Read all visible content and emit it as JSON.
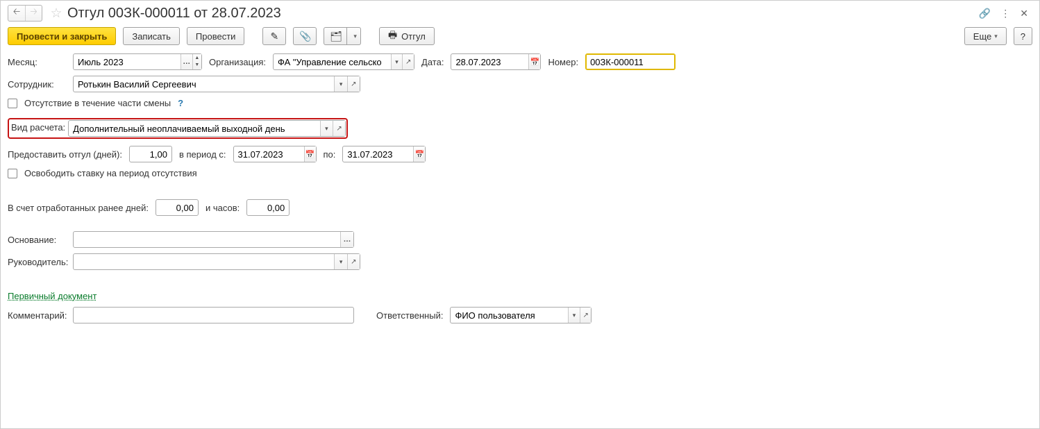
{
  "header": {
    "title": "Отгул 00ЗК-000011 от 28.07.2023"
  },
  "toolbar": {
    "post_and_close": "Провести и закрыть",
    "save": "Записать",
    "post": "Провести",
    "print_label": "Отгул",
    "more": "Еще",
    "help": "?"
  },
  "labels": {
    "month": "Месяц:",
    "organization": "Организация:",
    "date": "Дата:",
    "number": "Номер:",
    "employee": "Сотрудник:",
    "partial_shift": "Отсутствие в течение части смены",
    "calc_type": "Вид расчета:",
    "grant_days": "Предоставить отгул (дней):",
    "period_from": "в период с:",
    "period_to": "по:",
    "free_position": "Освободить ставку на период отсутствия",
    "by_worked_days": "В счет отработанных ранее дней:",
    "and_hours": "и часов:",
    "basis": "Основание:",
    "manager": "Руководитель:",
    "primary_doc": "Первичный документ",
    "comment": "Комментарий:",
    "responsible": "Ответственный:"
  },
  "values": {
    "month": "Июль 2023",
    "organization": "ФА \"Управление сельско",
    "date": "28.07.2023",
    "number": "00ЗК-000011",
    "employee": "Ротькин Василий Сергеевич",
    "calc_type": "Дополнительный неоплачиваемый выходной день",
    "grant_days": "1,00",
    "period_from": "31.07.2023",
    "period_to": "31.07.2023",
    "by_worked_days": "0,00",
    "and_hours": "0,00",
    "basis": "",
    "manager": "",
    "comment": "",
    "responsible": "ФИО пользователя"
  }
}
